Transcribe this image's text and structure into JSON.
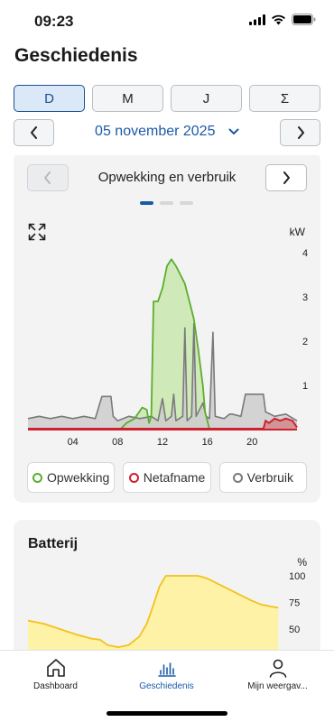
{
  "status": {
    "time": "09:23"
  },
  "header": {
    "title": "Geschiedenis"
  },
  "period_tabs": [
    {
      "label": "D",
      "active": true
    },
    {
      "label": "M",
      "active": false
    },
    {
      "label": "J",
      "active": false
    },
    {
      "label": "Σ",
      "active": false
    }
  ],
  "date_nav": {
    "date": "05 november 2025"
  },
  "production_card": {
    "title": "Opwekking en verbruik",
    "page_count": 3,
    "active_page": 0,
    "unit": "kW",
    "legend": [
      {
        "label": "Opwekking",
        "color": "#5cae2e"
      },
      {
        "label": "Netafname",
        "color": "#d0202f"
      },
      {
        "label": "Verbruik",
        "color": "#7a7a7a"
      }
    ]
  },
  "battery_card": {
    "title": "Batterij",
    "unit": "%"
  },
  "tabbar": [
    {
      "label": "Dashboard",
      "icon": "home-icon",
      "active": false
    },
    {
      "label": "Geschiedenis",
      "icon": "bar-chart-icon",
      "active": true
    },
    {
      "label": "Mijn weergav...",
      "icon": "person-icon",
      "active": false
    }
  ],
  "chart_data": [
    {
      "type": "area",
      "title": "",
      "xlabel": "",
      "ylabel": "kW",
      "xlim": [
        0,
        24
      ],
      "ylim": [
        0,
        4
      ],
      "x_ticks": [
        "04",
        "08",
        "12",
        "16",
        "20"
      ],
      "y_ticks": [
        "1",
        "2",
        "3",
        "4"
      ],
      "series": [
        {
          "name": "Opwekking",
          "color": "#5cae2e",
          "fill": "#cfe9b8",
          "points": [
            [
              0,
              0
            ],
            [
              8.2,
              0
            ],
            [
              8.8,
              0.15
            ],
            [
              9.5,
              0.25
            ],
            [
              10.2,
              0.5
            ],
            [
              10.6,
              0.45
            ],
            [
              10.8,
              0.15
            ],
            [
              11,
              0.3
            ],
            [
              11.2,
              2.9
            ],
            [
              11.6,
              2.9
            ],
            [
              12,
              3.2
            ],
            [
              12.4,
              3.7
            ],
            [
              12.8,
              3.85
            ],
            [
              13.2,
              3.7
            ],
            [
              13.6,
              3.5
            ],
            [
              14,
              3.3
            ],
            [
              14.4,
              2.9
            ],
            [
              14.8,
              2.5
            ],
            [
              15.2,
              1.8
            ],
            [
              15.6,
              1.0
            ],
            [
              15.8,
              0.4
            ],
            [
              16,
              0.2
            ],
            [
              16.2,
              0
            ],
            [
              24,
              0
            ]
          ]
        },
        {
          "name": "Netafname",
          "color": "#d0202f",
          "points": [
            [
              0,
              0.02
            ],
            [
              21,
              0.02
            ],
            [
              21.2,
              0.2
            ],
            [
              21.5,
              0.15
            ],
            [
              22,
              0.25
            ],
            [
              22.5,
              0.2
            ],
            [
              23,
              0.25
            ],
            [
              23.6,
              0.2
            ],
            [
              24,
              0.05
            ]
          ]
        },
        {
          "name": "Verbruik",
          "color": "#7a7a7a",
          "fill": "#cdcdcd",
          "points": [
            [
              0,
              0.25
            ],
            [
              1,
              0.3
            ],
            [
              2,
              0.25
            ],
            [
              3,
              0.3
            ],
            [
              4,
              0.25
            ],
            [
              5,
              0.3
            ],
            [
              6,
              0.25
            ],
            [
              6.6,
              0.75
            ],
            [
              7.4,
              0.75
            ],
            [
              7.6,
              0.3
            ],
            [
              8,
              0.2
            ],
            [
              9,
              0.3
            ],
            [
              10,
              0.25
            ],
            [
              11,
              0.3
            ],
            [
              11.6,
              0.2
            ],
            [
              12,
              0.7
            ],
            [
              12.3,
              0.2
            ],
            [
              12.8,
              0.3
            ],
            [
              13,
              0.8
            ],
            [
              13.2,
              0.2
            ],
            [
              13.8,
              0.3
            ],
            [
              14,
              2.3
            ],
            [
              14.2,
              0.2
            ],
            [
              14.6,
              0.3
            ],
            [
              14.8,
              2.4
            ],
            [
              15,
              0.3
            ],
            [
              15.6,
              0.6
            ],
            [
              15.9,
              0.3
            ],
            [
              16.2,
              0.25
            ],
            [
              16.5,
              2.2
            ],
            [
              16.7,
              0.3
            ],
            [
              17.5,
              0.25
            ],
            [
              18,
              0.35
            ],
            [
              18.2,
              0.35
            ],
            [
              19,
              0.3
            ],
            [
              19.4,
              0.8
            ],
            [
              21,
              0.8
            ],
            [
              21.2,
              0.4
            ],
            [
              22,
              0.3
            ],
            [
              23,
              0.35
            ],
            [
              24,
              0.2
            ]
          ]
        }
      ]
    },
    {
      "type": "area",
      "title": "",
      "xlabel": "",
      "ylabel": "%",
      "xlim": [
        0,
        24
      ],
      "ylim": [
        30,
        100
      ],
      "y_ticks": [
        "100",
        "75",
        "50"
      ],
      "series": [
        {
          "name": "Batterij",
          "color": "#f3c21b",
          "fill": "#fdf2a6",
          "points": [
            [
              0,
              58
            ],
            [
              1.5,
              55
            ],
            [
              3,
              50
            ],
            [
              4.5,
              45
            ],
            [
              6,
              41
            ],
            [
              6.8,
              40
            ],
            [
              7.5,
              35
            ],
            [
              8.5,
              33
            ],
            [
              9.5,
              35
            ],
            [
              10.5,
              43
            ],
            [
              11.2,
              55
            ],
            [
              11.8,
              72
            ],
            [
              12.4,
              90
            ],
            [
              13,
              100
            ],
            [
              14,
              100
            ],
            [
              15,
              100
            ],
            [
              16,
              100
            ],
            [
              16.4,
              99
            ],
            [
              17,
              97
            ],
            [
              18,
              92
            ],
            [
              19,
              87
            ],
            [
              20,
              82
            ],
            [
              21,
              77
            ],
            [
              22,
              73
            ],
            [
              23,
              71
            ],
            [
              23.6,
              70
            ]
          ]
        }
      ]
    }
  ]
}
